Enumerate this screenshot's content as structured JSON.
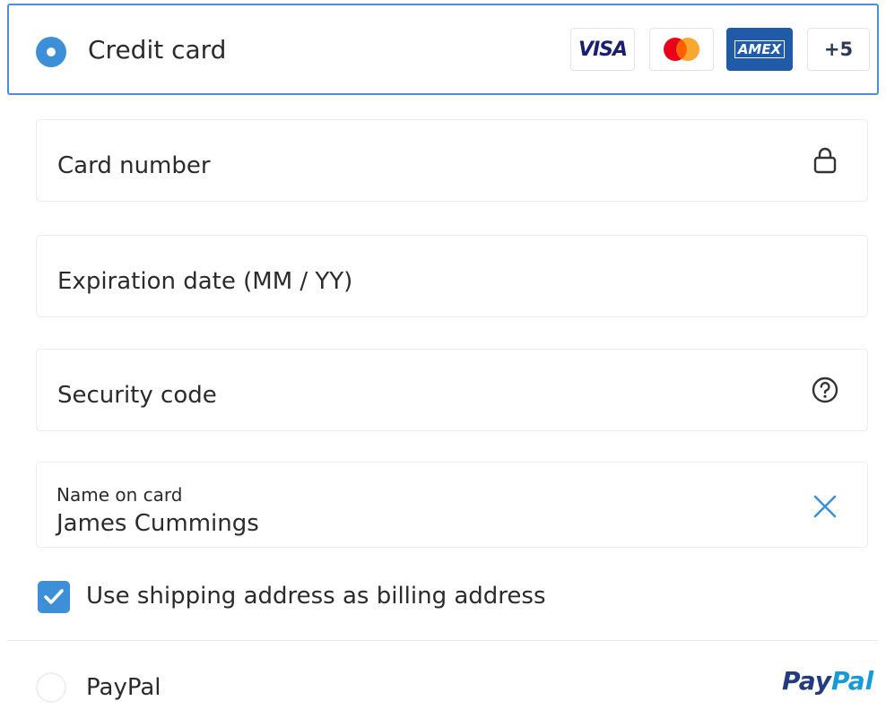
{
  "credit_card": {
    "title": "Credit card",
    "selected": true,
    "badges": {
      "visa": "VISA",
      "amex": "AMEX",
      "more": "+5"
    }
  },
  "form": {
    "card_number": {
      "placeholder": "Card number",
      "icon": "lock-icon"
    },
    "expiration": {
      "placeholder": "Expiration date (MM / YY)"
    },
    "security_code": {
      "placeholder": "Security code",
      "icon": "help-circle-icon"
    },
    "name_on_card": {
      "label": "Name on card",
      "value": "James Cummings",
      "icon": "clear-icon"
    }
  },
  "billing": {
    "checkbox_label": "Use shipping address as billing address",
    "checked": true
  },
  "paypal": {
    "label": "PayPal",
    "logo_part1": "Pay",
    "logo_part2": "Pal",
    "selected": false
  },
  "colors": {
    "accent": "#3d8fd8",
    "border_selected": "#4a90d9",
    "paypal_dark": "#253b80",
    "paypal_light": "#179bd7"
  }
}
